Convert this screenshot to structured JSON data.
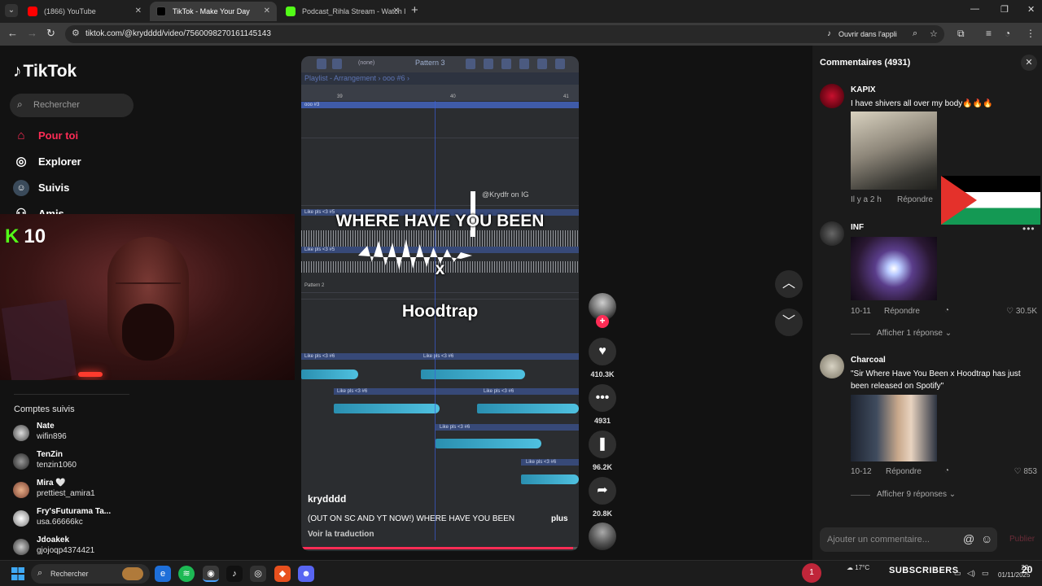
{
  "browser": {
    "tabs": [
      {
        "title": "(1866) YouTube",
        "color": "#ff0000"
      },
      {
        "title": "TikTok - Make Your Day",
        "color": "#000000"
      },
      {
        "title": "Podcast_Rihla Stream - Watch l",
        "color": "#53fc18"
      }
    ],
    "url": "tiktok.com/@krydddd/video/7560098270161145143",
    "open_app_label": "Ouvrir dans l'appli"
  },
  "sidebar": {
    "logo": "TikTok",
    "search_placeholder": "Rechercher",
    "nav": [
      {
        "label": "Pour toi",
        "icon": "home-icon"
      },
      {
        "label": "Explorer",
        "icon": "compass-icon"
      },
      {
        "label": "Suivis",
        "icon": "following-icon"
      },
      {
        "label": "Amis",
        "icon": "friends-icon"
      }
    ],
    "followed_title": "Comptes suivis",
    "followed": [
      {
        "name": "Nate",
        "username": "wifin896"
      },
      {
        "name": "TenZin",
        "username": "tenzin1060"
      },
      {
        "name": "Mira 🤍",
        "username": "prettiest_amira1"
      },
      {
        "name": "Fry'sFuturama Ta...",
        "username": "usa.66666kc"
      },
      {
        "name": "Jdoakek",
        "username": "gjojoqp4374421"
      }
    ]
  },
  "webcam": {
    "kick_count": "10"
  },
  "video": {
    "daw_pattern": "Pattern 3",
    "daw_none": "(none)",
    "playlist_title": "Playlist - Arrangement › ooo #6 ›",
    "ruler_marks": [
      "39",
      "40",
      "41"
    ],
    "clip_labels": [
      "ooo #3",
      "Like pls <3 #5",
      "Like pls <3 #5",
      "Pattern 2",
      "Like pls <3 #6",
      "Like pls <3 #6",
      "Like pls <3 #6",
      "Like pls <3 #6",
      "Like pls <3 #6",
      "Like pls <3 #6"
    ],
    "watermark": "@Krydfr on IG",
    "overlay_line1": "WHERE HAVE YOU BEEN",
    "overlay_line2": "x",
    "overlay_line3": "Hoodtrap",
    "author": "krydddd",
    "caption": "(OUT ON SC AND YT NOW!) WHERE HAVE YOU BEEN",
    "more": "plus",
    "translate": "Voir la traduction",
    "progress": 0.98
  },
  "actions": {
    "likes": "410.3K",
    "comments": "4931",
    "saves": "96.2K",
    "shares": "20.8K"
  },
  "comments_panel": {
    "title": "Commentaires (4931)",
    "items": [
      {
        "user": "KAPIX",
        "text": "I have shivers all over my body🔥🔥🔥",
        "time": "Il y a 2 h",
        "reply": "Répondre"
      },
      {
        "user": "INF",
        "time": "10-11",
        "reply": "Répondre",
        "likes": "30.5K",
        "more": "Afficher 1 réponse"
      },
      {
        "user": "Charcoal",
        "text": "\"Sir Where Have You Been x Hoodtrap has just been released on Spotify\"",
        "time": "10-12",
        "reply": "Répondre",
        "likes": "853",
        "more": "Afficher 9 réponses"
      }
    ],
    "input_placeholder": "Ajouter un commentaire...",
    "publish": "Publier"
  },
  "taskbar": {
    "search_placeholder": "Rechercher",
    "badge": "1",
    "temperature": "17°C",
    "subscribers_label": "SUBSCRIBERS",
    "subscribers_count": "20",
    "time": "22:",
    "date": "01/11/2025"
  }
}
